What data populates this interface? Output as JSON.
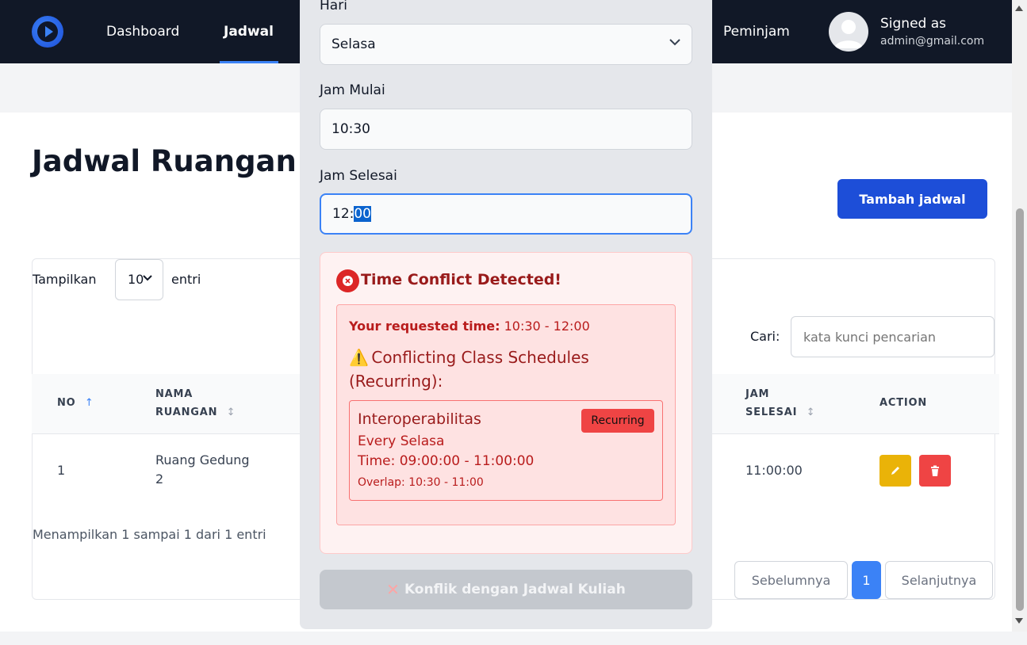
{
  "navbar": {
    "links": [
      "Dashboard",
      "Jadwal",
      "Peminjam"
    ],
    "user_signed": "Signed as",
    "user_email": "admin@gmail.com"
  },
  "page": {
    "title": "Jadwal Ruangan I",
    "add_button": "Tambah jadwal"
  },
  "table": {
    "show_label": "Tampilkan",
    "entries_value": "10",
    "entries_label": "entri",
    "search_label": "Cari:",
    "search_placeholder": "kata kunci pencarian",
    "headers": {
      "no": "NO",
      "nama_1": "NAMA",
      "nama_2": "RUANGAN",
      "jam_1": "JAM",
      "jam_2": "SELESAI",
      "action": "ACTION"
    },
    "sort_up": "↑",
    "sort_both": "↕",
    "rows": [
      {
        "no": "1",
        "ruangan_1": "Ruang Gedung",
        "ruangan_2": "2",
        "jam_selesai": "11:00:00"
      }
    ],
    "info": "Menampilkan 1 sampai 1 dari 1 entri",
    "pagination": {
      "prev": "Sebelumnya",
      "current": "1",
      "next": "Selanjutnya"
    }
  },
  "modal": {
    "hari_label": "Hari",
    "hari_value": "Selasa",
    "jam_mulai_label": "Jam Mulai",
    "jam_mulai_value": "10:30",
    "jam_selesai_label": "Jam Selesai",
    "jam_selesai_value_a": "12:",
    "jam_selesai_value_b": "00",
    "conflict": {
      "title": "Time Conflict Detected!",
      "requested_label": "Your requested time:",
      "requested_value": " 10:30 - 12:00",
      "warn_icon": "⚠️",
      "heading": "Conflicting Class Schedules (Recurring):",
      "schedule": {
        "name": "Interoperabilitas",
        "badge": "Recurring",
        "every": "Every Selasa",
        "time": "Time: 09:00:00 - 11:00:00",
        "overlap": "Overlap: 10:30 - 11:00"
      }
    },
    "submit_icon": "✕",
    "submit_label": "Konflik dengan Jadwal Kuliah"
  },
  "colors": {
    "navbar_bg": "#111827",
    "primary": "#1d4ed8",
    "danger": "#dc2626",
    "warning": "#eab308"
  }
}
